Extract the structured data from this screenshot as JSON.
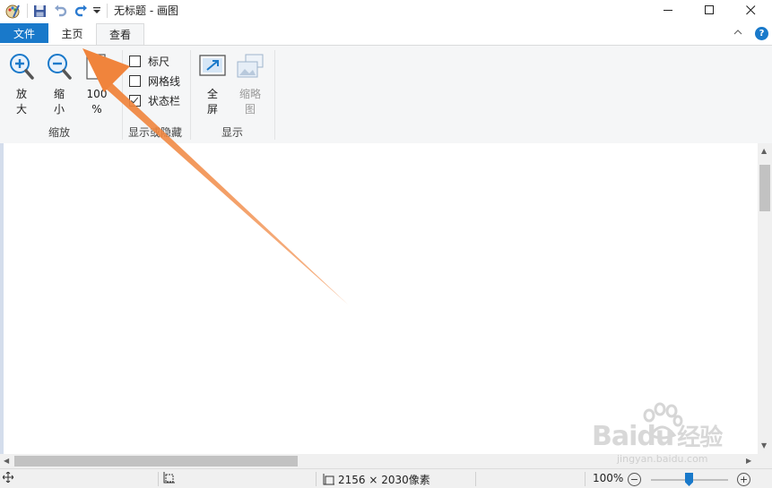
{
  "window": {
    "title": "无标题 - 画图"
  },
  "tabs": {
    "file": "文件",
    "home": "主页",
    "view": "查看"
  },
  "ribbon": {
    "zoom_in": [
      "放",
      "大"
    ],
    "zoom_out": [
      "缩",
      "小"
    ],
    "zoom_100": [
      "100",
      "%"
    ],
    "zoom_group": "缩放",
    "ruler": "标尺",
    "gridlines": "网格线",
    "statusbar": "状态栏",
    "ruler_checked": false,
    "gridlines_checked": false,
    "statusbar_checked": true,
    "showhide_group": "显示或隐藏",
    "fullscreen": [
      "全",
      "屏"
    ],
    "thumbnail": [
      "缩略",
      "图"
    ],
    "display_group": "显示"
  },
  "status": {
    "image_size": "2156 × 2030像素",
    "zoom": "100%"
  },
  "watermark": {
    "brand": "Bai",
    "brand2": "du",
    "brand_cn": "经验",
    "url": "jingyan.baidu.com"
  },
  "colors": {
    "accent": "#1979ca",
    "annotation_arrow": "#f0843c"
  }
}
